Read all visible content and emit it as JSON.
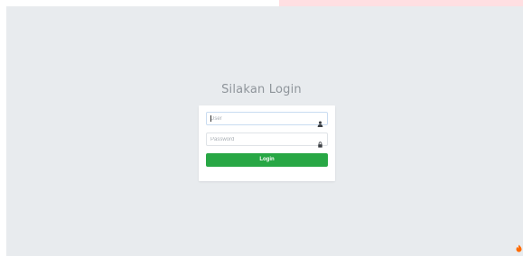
{
  "page": {
    "title": "Silakan Login"
  },
  "form": {
    "user_placeholder": "User",
    "user_value": "",
    "password_placeholder": "Password",
    "password_value": "",
    "user_icon": "user-icon",
    "password_icon": "lock-icon",
    "login_label": "Login"
  },
  "corner": {
    "icon": "flame-icon"
  },
  "colors": {
    "background": "#e8ebee",
    "card": "#ffffff",
    "login_button": "#28a745",
    "top_bar": "#ffdfe2",
    "corner_icon": "#ff6a00"
  }
}
